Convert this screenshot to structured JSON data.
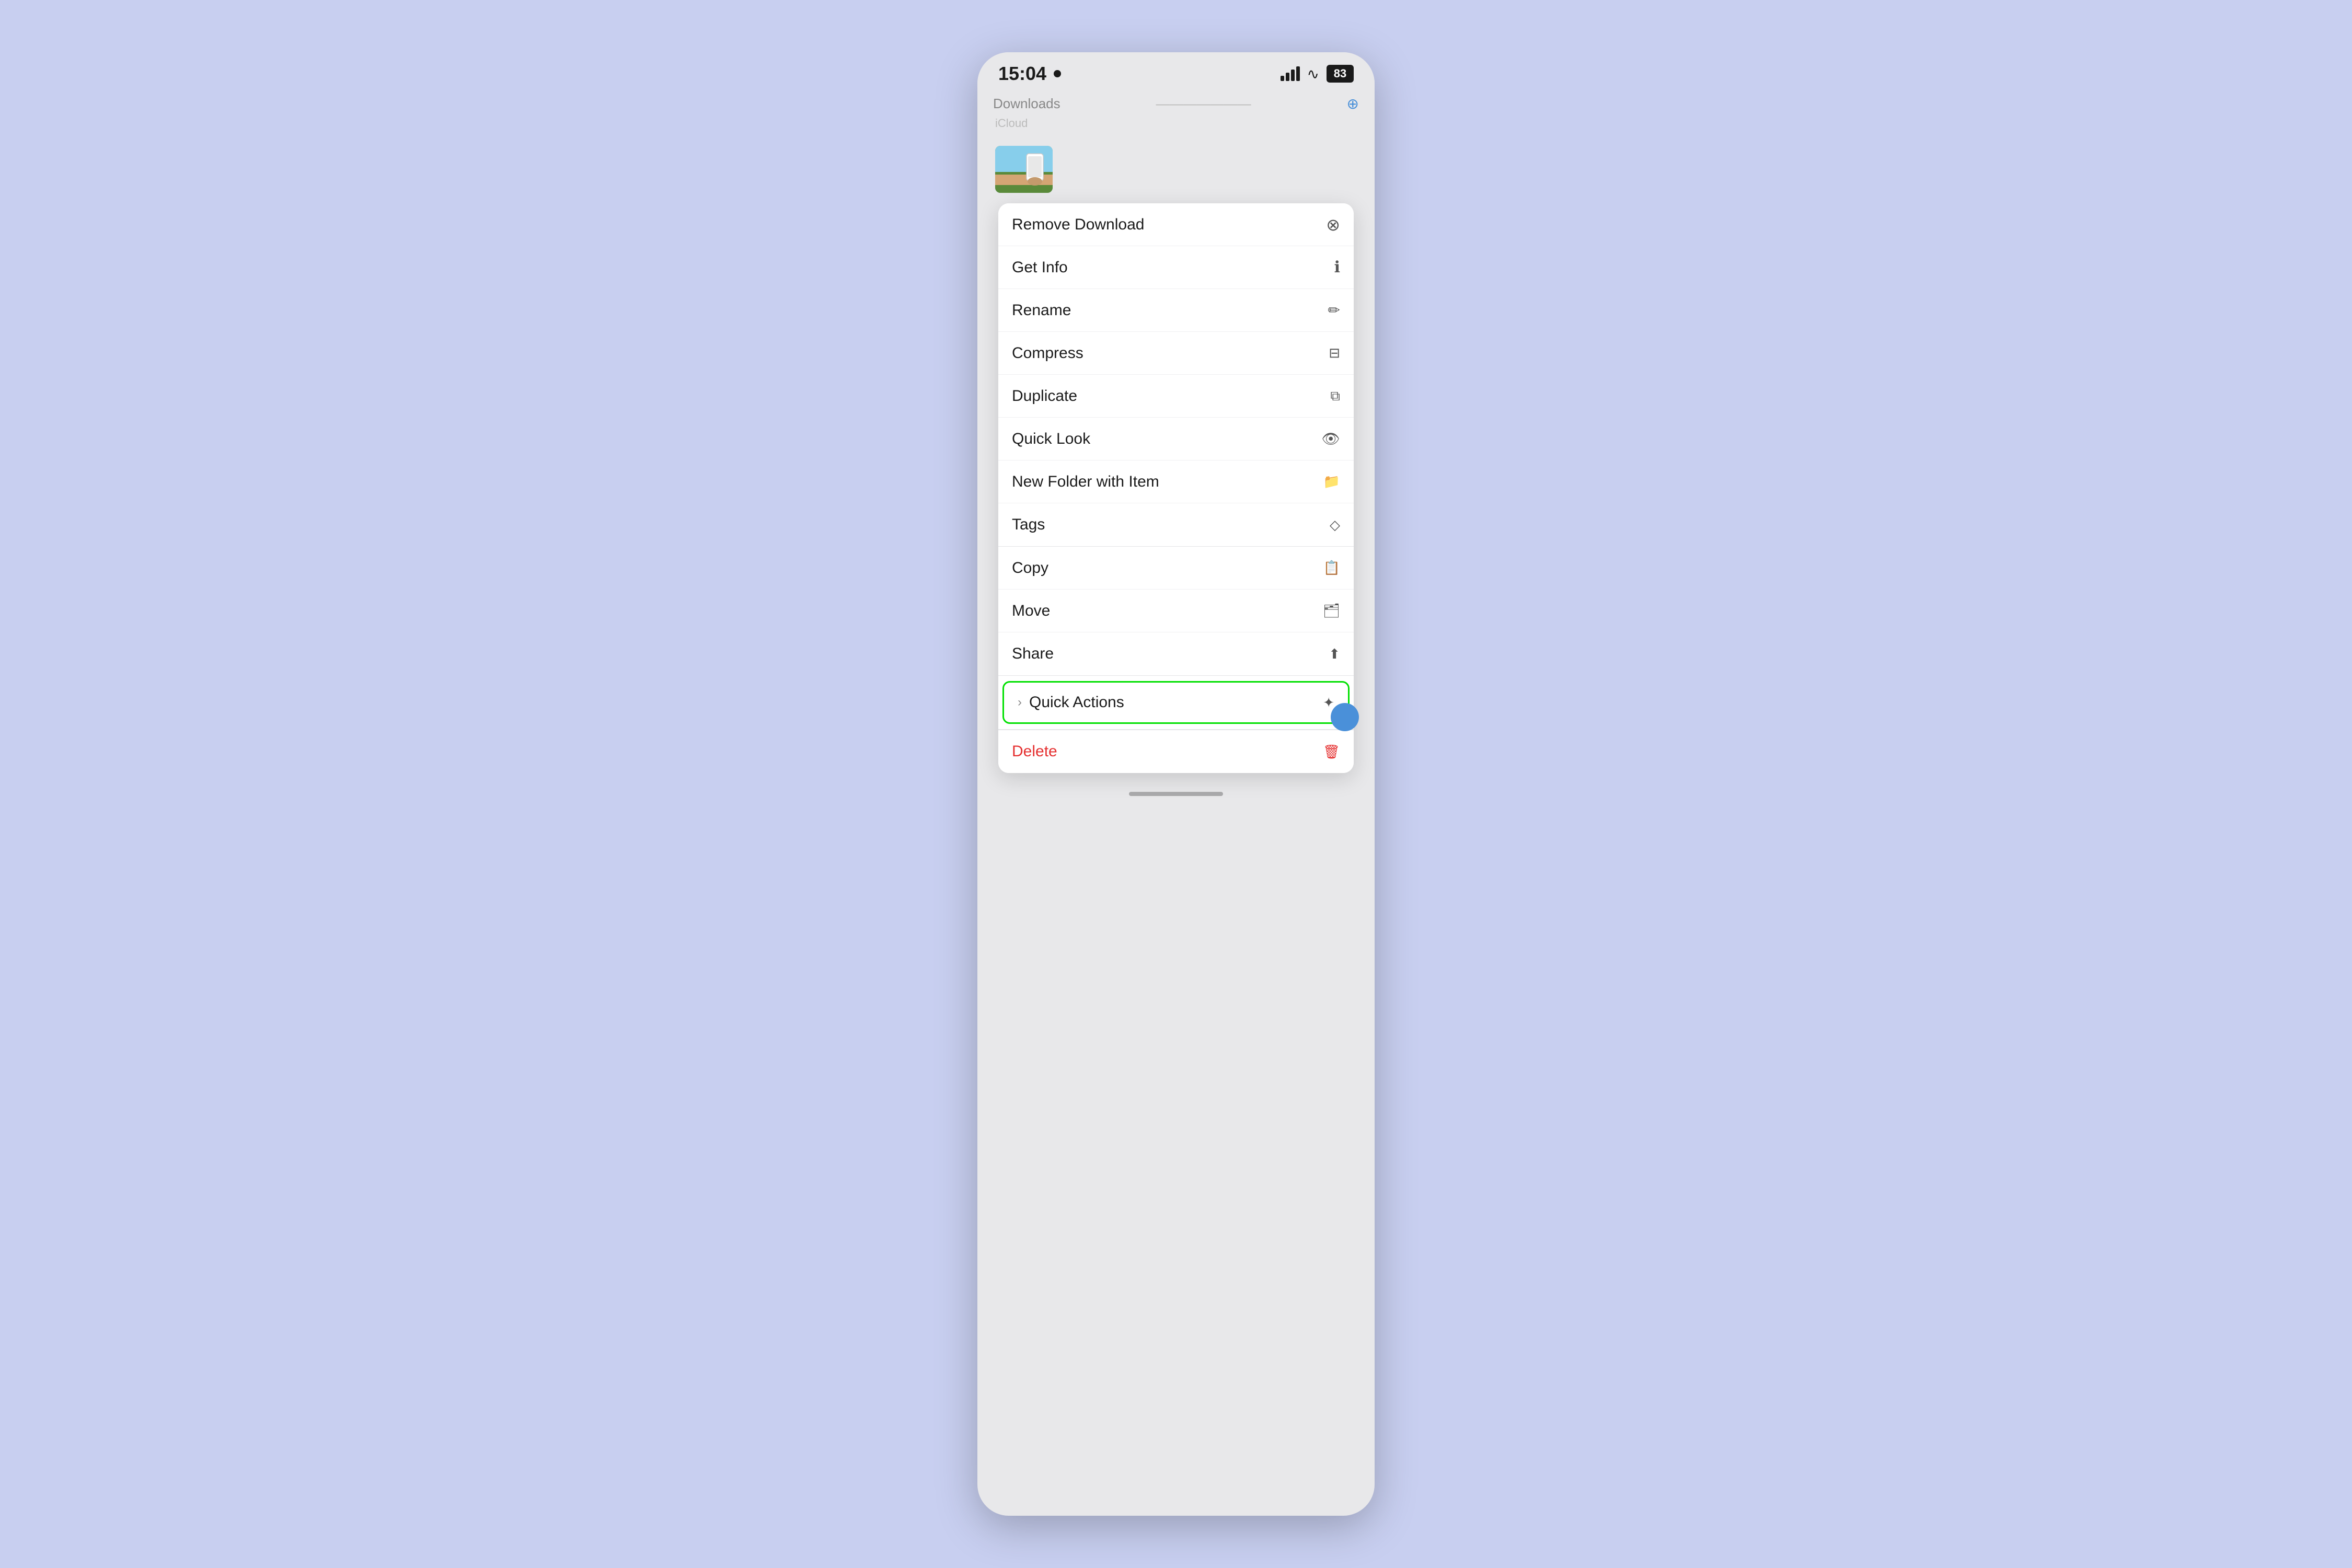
{
  "statusBar": {
    "time": "15:04",
    "battery": "83"
  },
  "header": {
    "backLabel": "< Downloads",
    "title": "...",
    "rightAction": "⊕"
  },
  "breadcrumb": "iCloud",
  "contextMenu": {
    "sections": [
      {
        "items": [
          {
            "label": "Remove Download",
            "icon": "⊗",
            "id": "remove-download"
          },
          {
            "label": "Get Info",
            "icon": "ⓘ",
            "id": "get-info"
          },
          {
            "label": "Rename",
            "icon": "✎",
            "id": "rename"
          },
          {
            "label": "Compress",
            "icon": "▣",
            "id": "compress"
          },
          {
            "label": "Duplicate",
            "icon": "⧉",
            "id": "duplicate"
          },
          {
            "label": "Quick Look",
            "icon": "👁",
            "id": "quick-look"
          },
          {
            "label": "New Folder with Item",
            "icon": "📁",
            "id": "new-folder"
          },
          {
            "label": "Tags",
            "icon": "◇",
            "id": "tags"
          }
        ]
      },
      {
        "items": [
          {
            "label": "Copy",
            "icon": "📋",
            "id": "copy"
          },
          {
            "label": "Move",
            "icon": "🗂",
            "id": "move"
          },
          {
            "label": "Share",
            "icon": "⬆",
            "id": "share"
          }
        ]
      },
      {
        "items": [
          {
            "label": "Quick Actions",
            "icon": "✦",
            "id": "quick-actions",
            "chevron": ">",
            "highlighted": true
          }
        ]
      },
      {
        "items": [
          {
            "label": "Delete",
            "icon": "🗑",
            "id": "delete",
            "red": true
          }
        ]
      }
    ]
  },
  "homeIndicator": "",
  "icons": {
    "remove": "⊗",
    "info": "ℹ",
    "rename": "✏",
    "compress": "▣",
    "duplicate": "⧉",
    "eye": "👁",
    "folder": "📁",
    "tag": "◇",
    "copy": "📋",
    "move": "🗂",
    "share": "⬆",
    "quickactions": "✦",
    "delete": "🗑",
    "chevron": "›"
  }
}
